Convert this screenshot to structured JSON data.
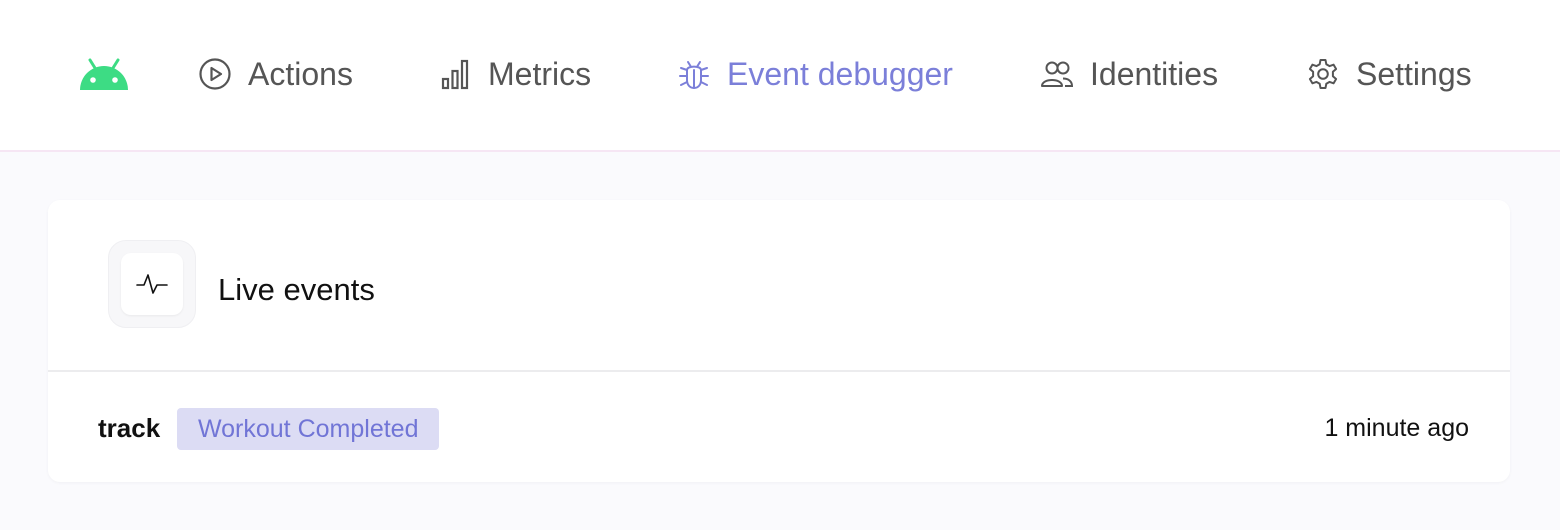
{
  "nav": {
    "logo_icon": "android-icon",
    "items": [
      {
        "label": "Actions",
        "icon": "play-circle-icon",
        "active": false
      },
      {
        "label": "Metrics",
        "icon": "bar-chart-icon",
        "active": false
      },
      {
        "label": "Event debugger",
        "icon": "bug-icon",
        "active": true
      },
      {
        "label": "Identities",
        "icon": "users-icon",
        "active": false
      },
      {
        "label": "Settings",
        "icon": "gear-icon",
        "active": false
      }
    ]
  },
  "card": {
    "icon": "pulse-icon",
    "title": "Live events",
    "events": [
      {
        "type": "track",
        "name": "Workout Completed",
        "time": "1 minute ago"
      }
    ]
  },
  "colors": {
    "accent": "#7b7fd9",
    "android_green": "#3ddc84",
    "badge_bg": "#dcdcf4",
    "nav_text": "#555555",
    "page_bg": "#fafafd"
  }
}
